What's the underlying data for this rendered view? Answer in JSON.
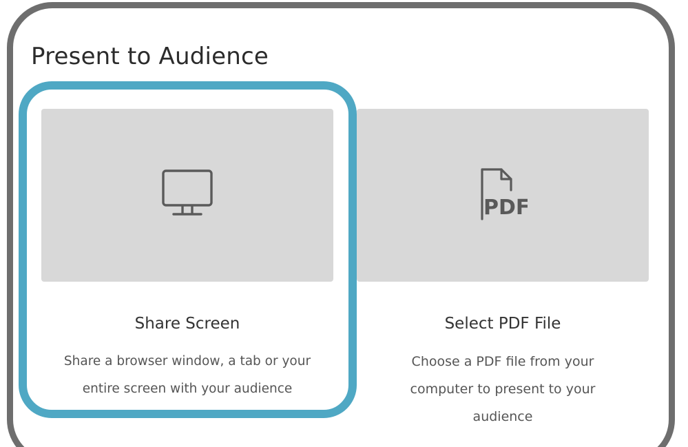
{
  "page": {
    "title": "Present to Audience"
  },
  "options": [
    {
      "icon": "monitor-icon",
      "title": "Share Screen",
      "description_lines": [
        "Share a browser window, a tab or your",
        "entire screen with your audience"
      ]
    },
    {
      "icon": "pdf-file-icon",
      "title": "Select PDF File",
      "description_lines": [
        "Choose a PDF file from your",
        "computer to present to your",
        "audience"
      ]
    }
  ],
  "colors": {
    "highlight": "#4fa8c4",
    "frame": "#6e6e6e",
    "card_background": "#d8d8d8",
    "icon": "#5a5a5a"
  }
}
